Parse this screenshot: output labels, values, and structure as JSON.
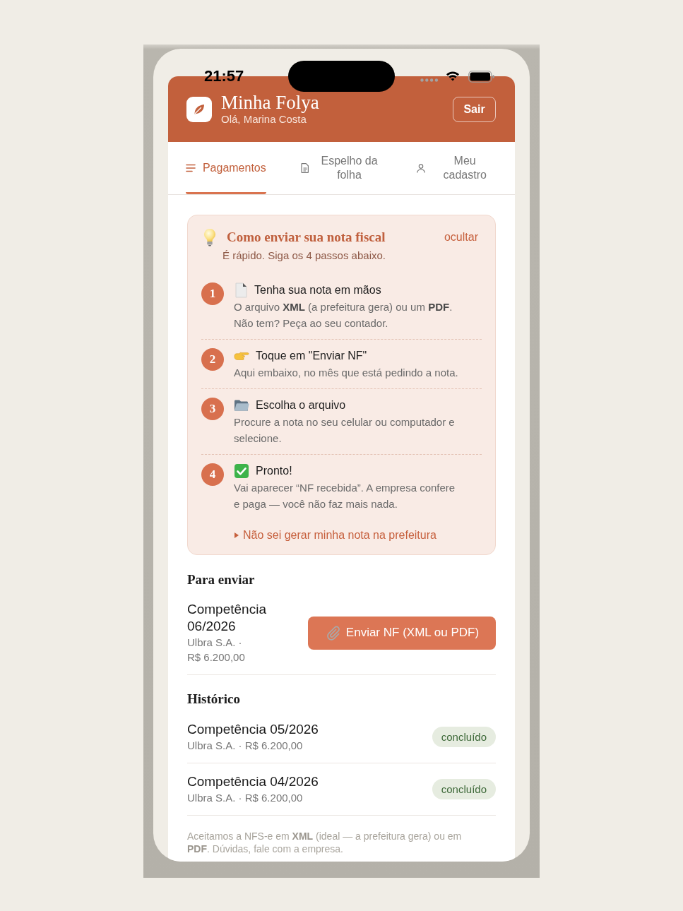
{
  "status_bar": {
    "time": "21:57"
  },
  "header": {
    "title": "Minha Folya",
    "greeting": "Olá, Marina Costa",
    "logout_button": "Sair"
  },
  "tabs": [
    {
      "label": "Pagamentos",
      "selected": true
    },
    {
      "label": "Espelho da folha",
      "selected": false
    },
    {
      "label": "Meu cadastro",
      "selected": false
    }
  ],
  "guide": {
    "title": "Como enviar sua nota fiscal",
    "hide_link": "ocultar",
    "subtitle": "É rápido. Siga os 4 passos abaixo.",
    "steps": [
      {
        "number": "1",
        "title": "Tenha sua nota em mãos",
        "text": "O arquivo **XML** (a prefeitura gera) ou um **PDF**. Não tem? Peça ao seu contador."
      },
      {
        "number": "2",
        "title": "Toque em \"Enviar NF\"",
        "text": "Aqui embaixo, no mês que está pedindo a nota."
      },
      {
        "number": "3",
        "title": "Escolha o arquivo",
        "text": "Procure a nota no seu celular ou computador e selecione."
      },
      {
        "number": "4",
        "title": "Pronto!",
        "text": "Vai aparecer “NF recebida”. A empresa confere e paga — você não faz mais nada."
      }
    ],
    "help_link": {
      "label": "Não sei gerar minha nota na prefeitura",
      "expanded": false
    }
  },
  "pending": {
    "heading": "Para enviar",
    "items": [
      {
        "period": "Competência 06/2026",
        "details": "Ulbra S.A. · R$ 6.200,00",
        "button": "Enviar NF (XML ou PDF)"
      }
    ]
  },
  "history": {
    "heading": "Histórico",
    "items": [
      {
        "period": "Competência 05/2026",
        "details": "Ulbra S.A. · R$ 6.200,00",
        "status": "concluído"
      },
      {
        "period": "Competência 04/2026",
        "details": "Ulbra S.A. · R$ 6.200,00",
        "status": "concluído"
      }
    ]
  },
  "footer_note": "Aceitamos a NFS-e em **XML** (ideal — a prefeitura gera) ou em **PDF**. Dúvidas, fale com a empresa."
}
